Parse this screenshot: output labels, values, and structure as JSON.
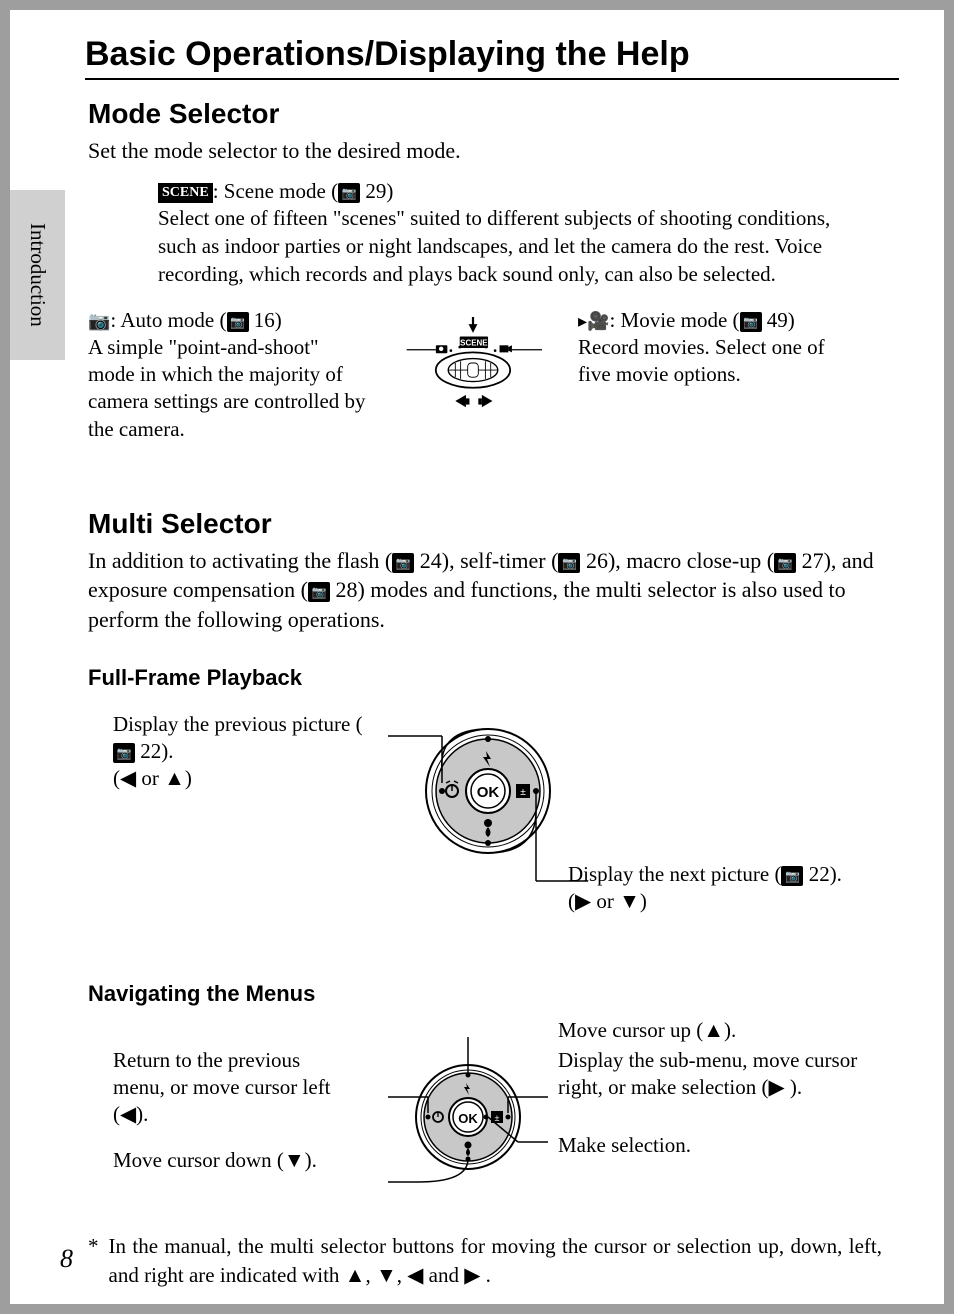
{
  "page_number": "8",
  "side_tab": "Introduction",
  "main_title": "Basic Operations/Displaying the Help",
  "mode_selector": {
    "heading": "Mode Selector",
    "intro": "Set the mode selector to the desired mode.",
    "scene": {
      "label": "SCENE",
      "title": ": Scene mode (",
      "page": "29",
      "close": ")",
      "desc": "Select one of fifteen \"scenes\" suited to different subjects of shooting conditions, such as indoor parties or night landscapes, and let the camera do the rest. Voice recording, which records and plays back sound only, can also be selected."
    },
    "auto": {
      "title": ": Auto mode (",
      "page": "16",
      "close": ")",
      "desc": "A simple \"point-and-shoot\" mode in which the majority of camera settings are controlled by the camera."
    },
    "movie": {
      "title": ": Movie mode (",
      "page": "49",
      "close": ")",
      "desc": "Record movies. Select one of five movie options."
    }
  },
  "multi_selector": {
    "heading": "Multi Selector",
    "intro_1": "In addition to activating the flash (",
    "p1": "24",
    "intro_2": "), self-timer (",
    "p2": "26",
    "intro_3": "), macro close-up (",
    "p3": "27",
    "intro_4": "), and exposure compensation (",
    "p4": "28",
    "intro_5": ") modes and functions, the multi selector is also used to perform the following operations.",
    "playback_heading": "Full-Frame Playback",
    "prev_label_1": "Display the previous picture (",
    "prev_page": "22",
    "prev_label_2": ").",
    "prev_label_3": "(◀ or ▲)",
    "next_label_1": "Display the next picture (",
    "next_page": "22",
    "next_label_2": ").",
    "next_label_3": "(▶ or ▼)",
    "nav_heading": "Navigating the Menus",
    "nav_up": "Move cursor up (▲).",
    "nav_left_1": "Return to the previous menu, or move cursor left (◀).",
    "nav_down": "Move cursor down (▼).",
    "nav_right": "Display the sub-menu, move cursor right, or make selection (▶ ).",
    "nav_select": "Make selection."
  },
  "footnote": {
    "mark": "*",
    "text": "In the manual, the multi selector buttons for moving the cursor or selection up, down, left, and right are indicated with ▲, ▼, ◀ and ▶ ."
  }
}
